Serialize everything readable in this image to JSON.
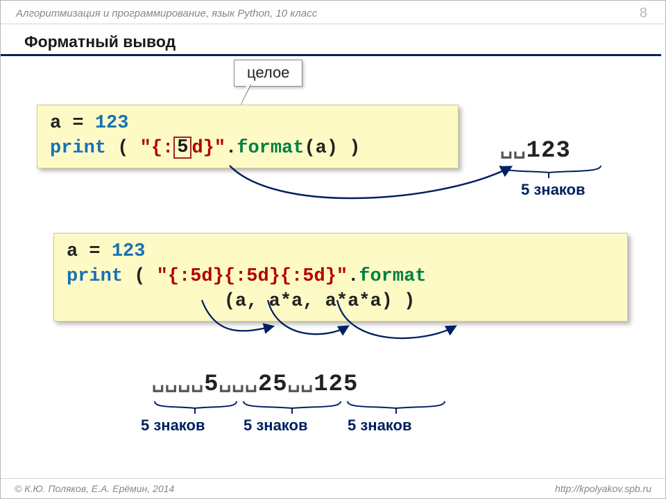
{
  "header": {
    "breadcrumb": "Алгоритмизация и программирование, язык Python, 10 класс",
    "page": "8"
  },
  "title": "Форматный вывод",
  "callout": "целое",
  "code1": {
    "line1_a": "a = ",
    "line1_num": "123",
    "line2_a": "print",
    "line2_b": " ( ",
    "line2_str_a": "\"{:",
    "boxed": "5",
    "line2_str_b": "d}\"",
    "line2_dot": ".",
    "line2_fmt": "format",
    "line2_tail": "(a) )"
  },
  "output1": {
    "pad": "␣␣",
    "value": "123"
  },
  "sign1": "5 знаков",
  "code2": {
    "line1_a": "a = ",
    "line1_num": "123",
    "line2_a": "print",
    "line2_b": " ( ",
    "line2_str": "\"{:5d}{:5d}{:5d}\"",
    "line2_dot": ".",
    "line2_fmt": "format",
    "line3": "              (a, a*a, a*a*a) )"
  },
  "output2": {
    "g1_pad": "␣␣␣␣",
    "g1_val": "5",
    "g2_pad": "␣␣␣",
    "g2_val": "25",
    "g3_pad": "␣␣",
    "g3_val": "125"
  },
  "signA": "5 знаков",
  "signB": "5 знаков",
  "signC": "5 знаков",
  "footer": {
    "left": "© К.Ю. Поляков, Е.А. Ерёмин, 2014",
    "right": "http://kpolyakov.spb.ru"
  }
}
